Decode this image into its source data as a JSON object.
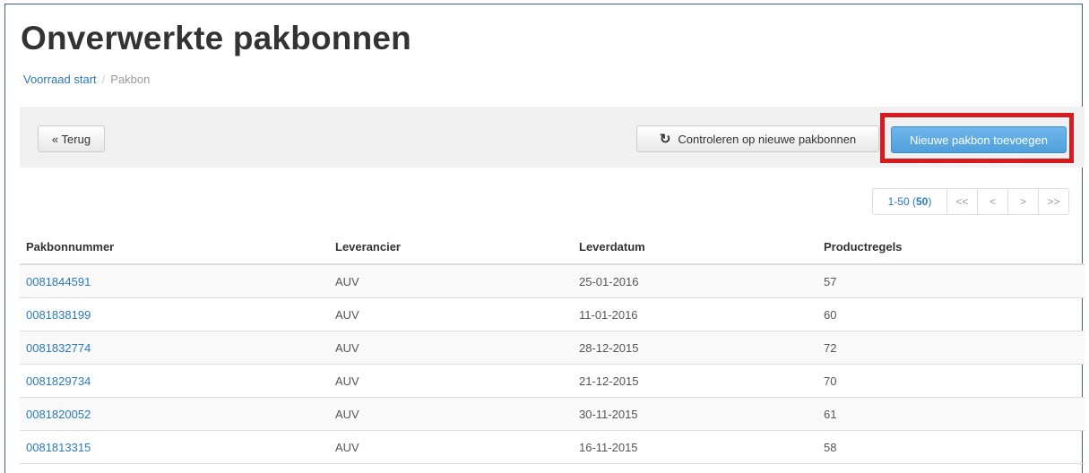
{
  "page": {
    "title": "Onverwerkte pakbonnen",
    "breadcrumb": {
      "home": "Voorraad start",
      "separator": "/",
      "current": "Pakbon"
    }
  },
  "toolbar": {
    "back_label": "« Terug",
    "check_label": "Controleren op nieuwe pakbonnen",
    "refresh_icon": "refresh-icon",
    "new_label": "Nieuwe pakbon toevoegen",
    "highlight_color": "#d71920"
  },
  "pagination": {
    "range_prefix": "1-50 (",
    "total": "50",
    "range_suffix": ")",
    "first": "<<",
    "prev": "<",
    "next": ">",
    "last": ">>"
  },
  "table": {
    "headers": [
      "Pakbonnummer",
      "Leverancier",
      "Leverdatum",
      "Productregels"
    ],
    "rows": [
      [
        "0081844591",
        "AUV",
        "25-01-2016",
        "57"
      ],
      [
        "0081838199",
        "AUV",
        "11-01-2016",
        "60"
      ],
      [
        "0081832774",
        "AUV",
        "28-12-2015",
        "72"
      ],
      [
        "0081829734",
        "AUV",
        "21-12-2015",
        "70"
      ],
      [
        "0081820052",
        "AUV",
        "30-11-2015",
        "61"
      ],
      [
        "0081813315",
        "AUV",
        "16-11-2015",
        "58"
      ]
    ]
  }
}
